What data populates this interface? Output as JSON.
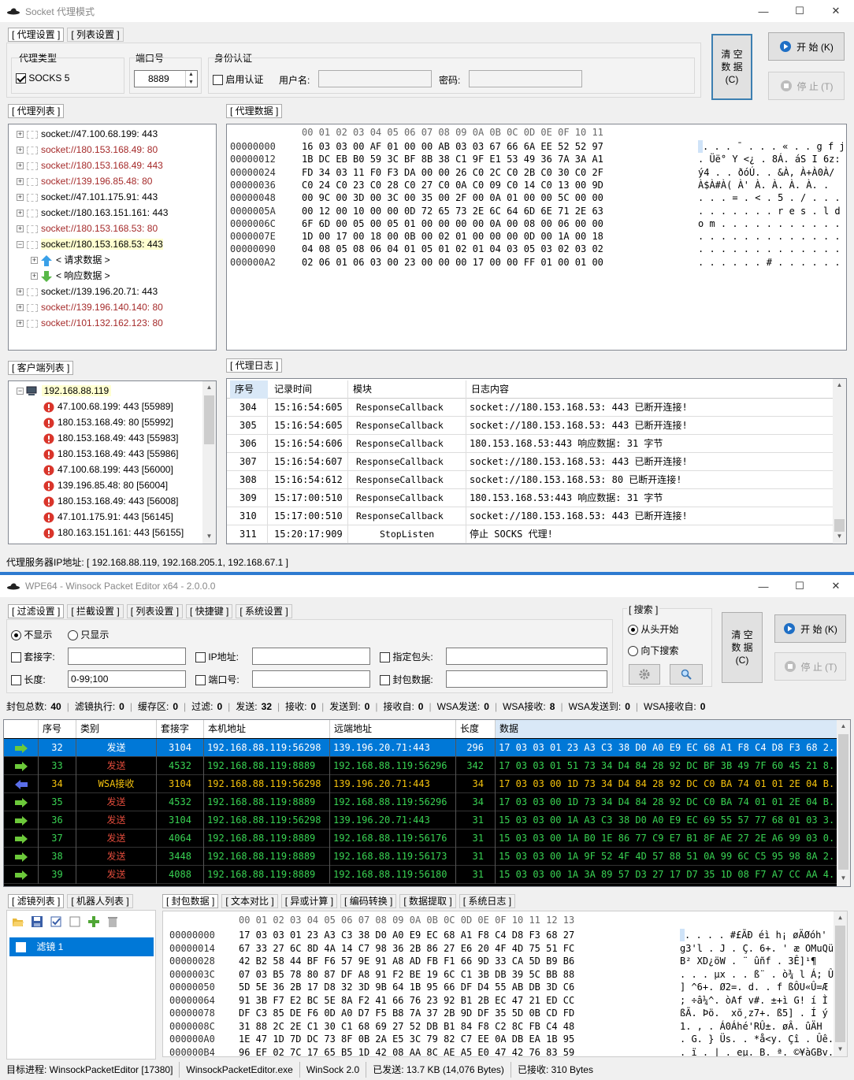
{
  "w1": {
    "title": "Socket 代理模式",
    "tabs": [
      "[ 代理设置 ]",
      "[ 列表设置 ]"
    ],
    "proxy_type_label": "代理类型",
    "socks5_label": "SOCKS 5",
    "port_label": "端口号",
    "port_value": "8889",
    "auth_label": "身份认证",
    "enable_auth_label": "启用认证",
    "username_label": "用户名:",
    "password_label": "密码:",
    "clear_btn": [
      "清 空",
      "数 据",
      "(C)"
    ],
    "start_btn": "开 始 (K)",
    "stop_btn": "停 止 (T)",
    "proxy_list_tab": "[ 代理列表 ]",
    "proxy_data_tab": "[ 代理数据 ]",
    "proxy_list": [
      {
        "text": "socket://47.100.68.199: 443",
        "red": false
      },
      {
        "text": "socket://180.153.168.49: 80",
        "red": true
      },
      {
        "text": "socket://180.153.168.49: 443",
        "red": true
      },
      {
        "text": "socket://139.196.85.48: 80",
        "red": true
      },
      {
        "text": "socket://47.101.175.91: 443",
        "red": false
      },
      {
        "text": "socket://180.163.151.161: 443",
        "red": false
      },
      {
        "text": "socket://180.153.168.53: 80",
        "red": true
      },
      {
        "text": "socket://180.153.168.53: 443",
        "red": false
      },
      {
        "text": "< 请求数据 >",
        "red": false
      },
      {
        "text": "< 响应数据 >",
        "red": false
      },
      {
        "text": "socket://139.196.20.71: 443",
        "red": false
      },
      {
        "text": "socket://139.196.140.140: 80",
        "red": true
      },
      {
        "text": "socket://101.132.162.123: 80",
        "red": true
      }
    ],
    "hex_header": "00 01 02 03 04 05 06 07 08 09 0A 0B 0C 0D 0E 0F 10 11",
    "hex_offsets": [
      "00000000",
      "00000012",
      "00000024",
      "00000036",
      "00000048",
      "0000005A",
      "0000006C",
      "0000007E",
      "00000090",
      "000000A2"
    ],
    "hex_bytes": [
      "16 03 03 00 AF 01 00 00 AB 03 03 67 66 6A EE 52 52 97",
      "1B DC EB B0 59 3C BF 8B 38 C1 9F E1 53 49 36 7A 3A A1",
      "FD 34 03 11 F0 F3 DA 00 00 26 C0 2C C0 2B C0 30 C0 2F",
      "C0 24 C0 23 C0 28 C0 27 C0 0A C0 09 C0 14 C0 13 00 9D",
      "00 9C 00 3D 00 3C 00 35 00 2F 00 0A 01 00 00 5C 00 00",
      "00 12 00 10 00 00 0D 72 65 73 2E 6C 64 6D 6E 71 2E 63",
      "6F 6D 00 05 00 05 01 00 00 00 00 0A 00 08 00 06 00 00",
      "1D 00 17 00 18 00 0B 00 02 01 00 00 00 0D 00 1A 00 18",
      "04 08 05 08 06 04 01 05 01 02 01 04 03 05 03 02 03 02",
      "02 06 01 06 03 00 23 00 00 00 17 00 00 FF 01 00 01 00"
    ],
    "hex_ascii": [
      ". . . ¯ . . . « . . g f j î R R .",
      ". Üë° Y <¿ . 8Á. áS I 6z: ¡",
      "ý4 . . ðóÚ. . &À, À+À0À/",
      "À$À#À( À' À. À. À. À. .",
      ". . . = . < . 5 . / . . . . . \\ . .",
      ". . . . . . . r e s . l d m n q . c",
      "o m . . . . . . . . . . . . . . . .",
      ". . . . . . . . . . . . . . . . . .",
      ". . . . . . . . . . . . . . . . . .",
      ". . . . . . # . . . . . . ÿ . . . ."
    ],
    "client_list_tab": "[ 客户端列表 ]",
    "client_root": "192.168.88.119",
    "client_list": [
      "47.100.68.199: 443 [55989]",
      "180.153.168.49: 80 [55992]",
      "180.153.168.49: 443 [55983]",
      "180.153.168.49: 443 [55986]",
      "47.100.68.199: 443 [56000]",
      "139.196.85.48: 80 [56004]",
      "180.153.168.49: 443 [56008]",
      "47.101.175.91: 443 [56145]",
      "180.163.151.161: 443 [56155]"
    ],
    "log_tab": "[ 代理日志 ]",
    "log_headers": [
      "序号",
      "记录时间",
      "模块",
      "日志内容"
    ],
    "log_rows": [
      [
        "304",
        "15:16:54:605",
        "ResponseCallback",
        "socket://180.153.168.53: 443 已断开连接!"
      ],
      [
        "305",
        "15:16:54:605",
        "ResponseCallback",
        "socket://180.153.168.53: 443 已断开连接!"
      ],
      [
        "306",
        "15:16:54:606",
        "ResponseCallback",
        "180.153.168.53:443 响应数据: 31 字节"
      ],
      [
        "307",
        "15:16:54:607",
        "ResponseCallback",
        "socket://180.153.168.53: 443 已断开连接!"
      ],
      [
        "308",
        "15:16:54:612",
        "ResponseCallback",
        "socket://180.153.168.53: 80 已断开连接!"
      ],
      [
        "309",
        "15:17:00:510",
        "ResponseCallback",
        "180.153.168.53:443 响应数据: 31 字节"
      ],
      [
        "310",
        "15:17:00:510",
        "ResponseCallback",
        "socket://180.153.168.53: 443 已断开连接!"
      ],
      [
        "311",
        "15:20:17:909",
        "StopListen",
        "停止 SOCKS 代理!"
      ]
    ],
    "status": "代理服务器IP地址: [ 192.168.88.119, 192.168.205.1, 192.168.67.1 ]"
  },
  "w2": {
    "title": "WPE64 - Winsock Packet Editor x64 - 2.0.0.0",
    "tabs": [
      "[ 过滤设置 ]",
      "[ 拦截设置 ]",
      "[ 列表设置 ]",
      "[ 快捷键 ]",
      "[ 系统设置 ]"
    ],
    "no_show": "不显示",
    "only_show": "只显示",
    "socket_label": "套接字:",
    "ip_label": "IP地址:",
    "head_label": "指定包头:",
    "len_label": "长度:",
    "len_value": "0-99;100",
    "port_label": "端口号:",
    "pkt_label": "封包数据:",
    "search_label": "[ 搜索 ]",
    "from_start": "从头开始",
    "search_down": "向下搜索",
    "clear_btn": [
      "清 空",
      "数 据",
      "(C)"
    ],
    "start_btn": "开 始 (K)",
    "stop_btn": "停 止 (T)",
    "stats": [
      [
        "封包总数:",
        "40"
      ],
      [
        "滤镜执行:",
        "0"
      ],
      [
        "缓存区:",
        "0"
      ],
      [
        "过滤:",
        "0"
      ],
      [
        "发送:",
        "32"
      ],
      [
        "接收:",
        "0"
      ],
      [
        "发送到:",
        "0"
      ],
      [
        "接收自:",
        "0"
      ],
      [
        "WSA发送:",
        "0"
      ],
      [
        "WSA接收:",
        "8"
      ],
      [
        "WSA发送到:",
        "0"
      ],
      [
        "WSA接收自:",
        "0"
      ]
    ],
    "pkt_headers": [
      "",
      "序号",
      "类别",
      "套接字",
      "本机地址",
      "远端地址",
      "长度",
      "数据"
    ],
    "pkt_rows": [
      {
        "dir": "send",
        "no": "32",
        "type": "发送",
        "sock": "3104",
        "local": "192.168.88.119:56298",
        "remote": "139.196.20.71:443",
        "len": "296",
        "data": "17 03 03 01 23 A3 C3 38 D0 A0 E9 EC 68 A1 F8 C4 D8 F3 68 2..."
      },
      {
        "dir": "send",
        "no": "33",
        "type": "发送",
        "sock": "4532",
        "local": "192.168.88.119:8889",
        "remote": "192.168.88.119:56296",
        "len": "342",
        "data": "17 03 03 01 51 73 34 D4 84 28 92 DC BF 3B 49 7F 60 45 21 8..."
      },
      {
        "dir": "recv",
        "no": "34",
        "type": "WSA接收",
        "sock": "3104",
        "local": "192.168.88.119:56298",
        "remote": "139.196.20.71:443",
        "len": "34",
        "data": "17 03 03 00 1D 73 34 D4 84 28 92 DC C0 BA 74 01 01 2E 04 B..."
      },
      {
        "dir": "send",
        "no": "35",
        "type": "发送",
        "sock": "4532",
        "local": "192.168.88.119:8889",
        "remote": "192.168.88.119:56296",
        "len": "34",
        "data": "17 03 03 00 1D 73 34 D4 84 28 92 DC C0 BA 74 01 01 2E 04 B..."
      },
      {
        "dir": "send",
        "no": "36",
        "type": "发送",
        "sock": "3104",
        "local": "192.168.88.119:56298",
        "remote": "139.196.20.71:443",
        "len": "31",
        "data": "15 03 03 00 1A A3 C3 38 D0 A0 E9 EC 69 55 57 77 68 01 03 3..."
      },
      {
        "dir": "send",
        "no": "37",
        "type": "发送",
        "sock": "4064",
        "local": "192.168.88.119:8889",
        "remote": "192.168.88.119:56176",
        "len": "31",
        "data": "15 03 03 00 1A B0 1E 86 77 C9 E7 B1 8F AE 27 2E A6 99 03 0..."
      },
      {
        "dir": "send",
        "no": "38",
        "type": "发送",
        "sock": "3448",
        "local": "192.168.88.119:8889",
        "remote": "192.168.88.119:56173",
        "len": "31",
        "data": "15 03 03 00 1A 9F 52 4F 4D 57 88 51 0A 99 6C C5 95 98 8A 2..."
      },
      {
        "dir": "send",
        "no": "39",
        "type": "发送",
        "sock": "4088",
        "local": "192.168.88.119:8889",
        "remote": "192.168.88.119:56180",
        "len": "31",
        "data": "15 03 03 00 1A 3A 89 57 D3 27 17 D7 35 1D 08 F7 A7 CC AA 4..."
      }
    ],
    "left_tabs": [
      "[ 滤镜列表 ]",
      "[ 机器人列表 ]"
    ],
    "filter_item": "滤镜 1",
    "right_tabs": [
      "[ 封包数据 ]",
      "[ 文本对比 ]",
      "[ 异或计算 ]",
      "[ 编码转换 ]",
      "[ 数据提取 ]",
      "[ 系统日志 ]"
    ],
    "hex_header": "00 01 02 03 04 05 06 07 08 09 0A 0B 0C 0D 0E 0F 10 11 12 13",
    "hex_offsets": [
      "00000000",
      "00000014",
      "00000028",
      "0000003C",
      "00000050",
      "00000064",
      "00000078",
      "0000008C",
      "000000A0",
      "000000B4"
    ],
    "hex_bytes": [
      "17 03 03 01 23 A3 C3 38 D0 A0 E9 EC 68 A1 F8 C4 D8 F3 68 27",
      "67 33 27 6C 8D 4A 14 C7 98 36 2B 86 27 E6 20 4F 4D 75 51 FC",
      "42 B2 58 44 BF F6 57 9E 91 A8 AD FB F1 66 9D 33 CA 5D B9 B6",
      "07 03 B5 78 80 87 DF A8 91 F2 BE 19 6C C1 3B DB 39 5C BB 88",
      "5D 5E 36 2B 17 D8 32 3D 9B 64 1B 95 66 DF D4 55 AB DB 3D C6",
      "91 3B F7 E2 BC 5E 8A F2 41 66 76 23 92 B1 2B EC 47 21 ED CC",
      "DF C3 85 DE F6 0D A0 D7 F5 B8 7A 37 2B 9D DF 35 5D 0B CD FD",
      "31 88 2C 2E C1 30 C1 68 69 27 52 DB B1 84 F8 C2 8C FB C4 48",
      "1E 47 1D 7D DC 73 8F 0B 2A E5 3C 79 82 C7 EE 0A DB EA 1B 95",
      "96 EF 02 7C 17 65 B5 1D 42 08 AA 8C AE A5 E0 47 42 76 83 59"
    ],
    "hex_ascii": [
      ". . . . #£ÃÐ éì h¡ øÄØóh'",
      "g3'l . J . Ç. 6+. ' æ OMuQü",
      "B² XD¿öW . ¨ ûñf . 3Ê]¹¶",
      ". . . µx . . ß¨ . ò¾ l Á; Û9\\». .",
      "] ^6+. Ø2=. d. . f ßÔU«Û=Æ",
      "; ÷â¼^. òAf v#. ±+ì G! í Ì",
      "ßÃ. Þö.  xõ¸z7+. ß5] . Í ý",
      "1. , . Á0Áhé'RÛ±. øÂ. ûÄH",
      ". G. } Üs. . *å<y. Çî . Ûê. .",
      ". ï . | . eµ. B. ª. ©¥àGBv. Y"
    ],
    "status": [
      "目标进程: WinsockPacketEditor [17380]",
      "WinsockPacketEditor.exe",
      "WinSock 2.0",
      "已发送: 13.7 KB (14,076 Bytes)",
      "已接收: 310 Bytes"
    ]
  }
}
